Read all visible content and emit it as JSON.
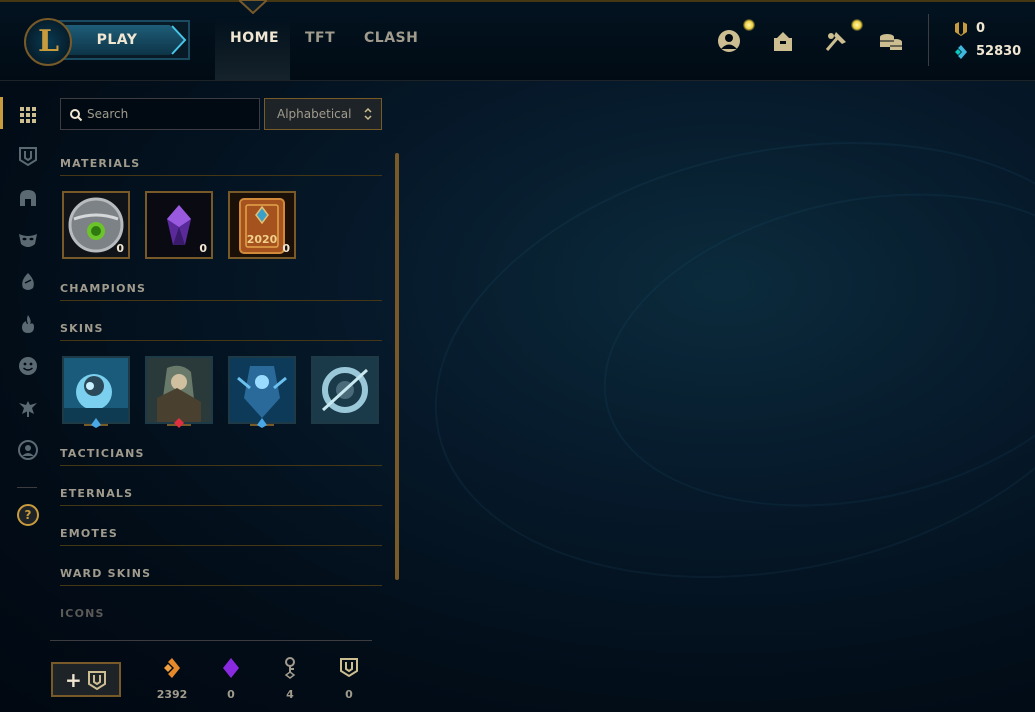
{
  "header": {
    "play_label": "PLAY",
    "tabs": [
      {
        "label": "HOME",
        "active": true
      },
      {
        "label": "TFT",
        "active": false
      },
      {
        "label": "CLASH",
        "active": false
      }
    ],
    "icons": [
      "profile-icon",
      "collection-icon",
      "loot-icon",
      "store-icon"
    ],
    "currency": {
      "rp": "0",
      "blue_essence": "52830"
    }
  },
  "sidebar": {
    "icons": [
      "grid-icon",
      "chest-icon",
      "helmet-icon",
      "mask-icon",
      "egg-icon",
      "flame-icon",
      "emote-icon",
      "tactician-icon",
      "profile-circle-icon",
      "help-icon"
    ],
    "help_label": "?"
  },
  "toolbar": {
    "search_placeholder": "Search",
    "sort_label": "Alphabetical"
  },
  "sections": {
    "materials": "MATERIALS",
    "champions": "CHAMPIONS",
    "skins": "SKINS",
    "tacticians": "TACTICIANS",
    "eternals": "ETERNALS",
    "emotes": "EMOTES",
    "ward_skins": "WARD SKINS",
    "icons": "ICONS"
  },
  "materials": [
    {
      "name": "capsule",
      "count": "0"
    },
    {
      "name": "gemstone",
      "count": "0"
    },
    {
      "name": "event-token",
      "count": "0",
      "year": "2020"
    }
  ],
  "skins": [
    {
      "name": "skin-1",
      "rarity": "blue"
    },
    {
      "name": "skin-2",
      "rarity": "red"
    },
    {
      "name": "skin-3",
      "rarity": "blue"
    },
    {
      "name": "skin-4",
      "rarity": "none"
    }
  ],
  "footer": {
    "add_label": "+",
    "orange_essence": "2392",
    "gemstones": "0",
    "keys": "4",
    "chests": "0"
  },
  "colors": {
    "gold": "#c89b3c",
    "gold_dark": "#785a28",
    "text": "#a09b8c",
    "bright": "#f0e6d2",
    "blue": "#0ac8b9"
  }
}
